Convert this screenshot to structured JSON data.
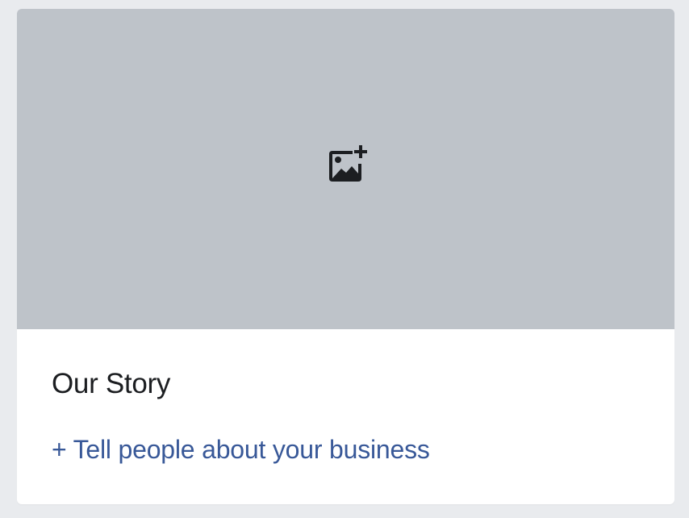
{
  "story_card": {
    "cover": {
      "icon": "add-photo-icon"
    },
    "title": "Our Story",
    "add_link_label": "+ Tell people about your business"
  },
  "colors": {
    "page_background": "#e9ebee",
    "cover_background": "#bec3c9",
    "icon": "#1c1e21",
    "title_text": "#1c1e21",
    "link_text": "#385898"
  }
}
